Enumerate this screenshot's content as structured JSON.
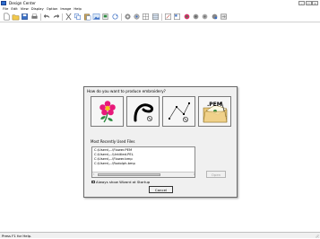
{
  "window": {
    "title": "Design Center",
    "controls": [
      "–",
      "□",
      "×"
    ]
  },
  "menu": {
    "items": [
      "File",
      "Edit",
      "View",
      "Display",
      "Option",
      "Image",
      "Help"
    ]
  },
  "toolbar": {
    "icons": [
      "new-icon",
      "open-icon",
      "save-icon",
      "print-icon",
      "undo-icon",
      "redo-icon",
      "cut-icon",
      "copy-icon",
      "paste-icon",
      "image-icon",
      "import-icon",
      "rotate-icon",
      "settings-icon",
      "settings2-icon",
      "grid-icon",
      "grid2-icon",
      "scale-icon",
      "layout-icon",
      "color-icon",
      "color2-icon",
      "color3-icon",
      "color4-icon",
      "export-icon"
    ]
  },
  "status": {
    "text": "Press F1 for Help."
  },
  "dialog": {
    "title": "How do you want to produce embroidery?",
    "wizard_buttons": [
      "image-to-stitch",
      "outline",
      "stitch-points",
      "open-pem"
    ],
    "pem_label": ".PEM",
    "mru_label": "Most Recently Used Files",
    "mru_files": [
      "C:\\Users\\...\\Flower.PEM",
      "C:\\Users\\...\\Untitled.PEL",
      "C:\\Users\\...\\Flower.bmp",
      "C:\\Users\\...\\Rudolph.bmp"
    ],
    "open_label": "Open",
    "checkbox_checked": true,
    "checkbox_label": "Always show Wizard at Startup",
    "cancel_label": "Cancel"
  },
  "colors": {
    "accent": "#2e6fd0",
    "dialog_bg": "#f0f0f0",
    "flower_petals": "#e8197a"
  }
}
